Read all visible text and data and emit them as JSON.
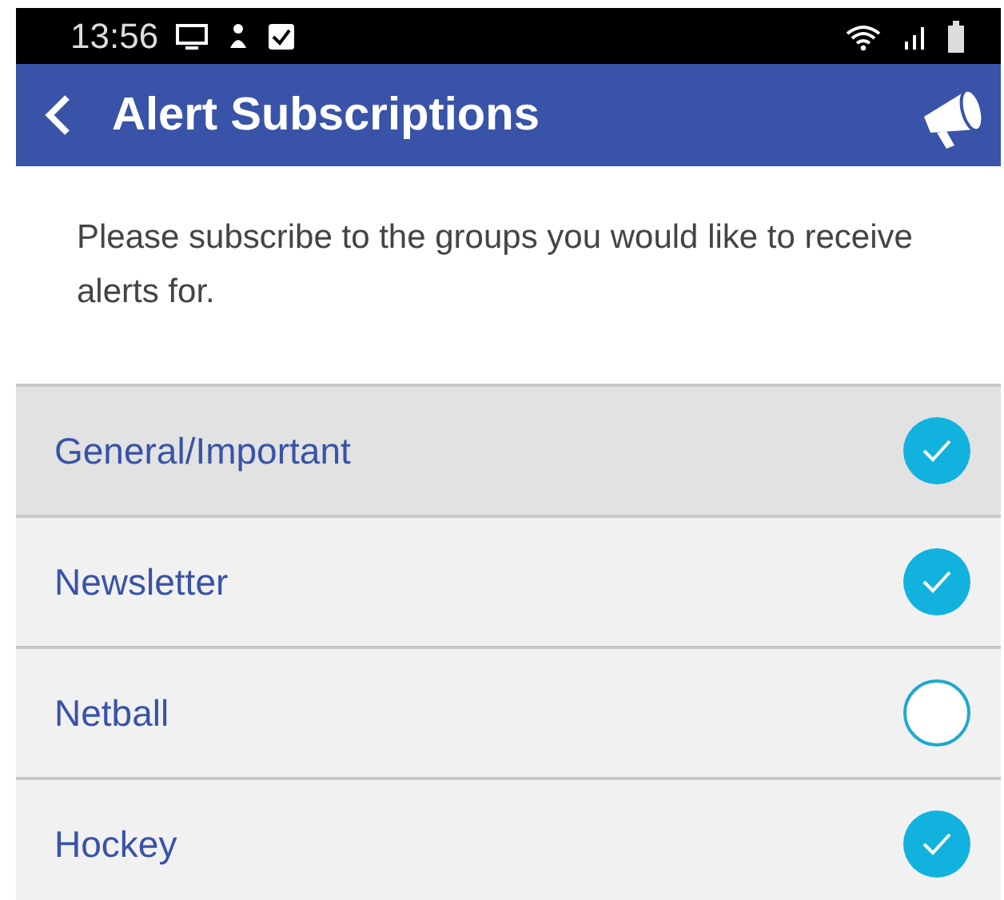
{
  "status_bar": {
    "time": "13:56"
  },
  "app_bar": {
    "title": "Alert Subscriptions"
  },
  "intro": "Please subscribe to the groups you would like to receive alerts for.",
  "groups": [
    {
      "label": "General/Important",
      "checked": true,
      "selected": true
    },
    {
      "label": "Newsletter",
      "checked": true,
      "selected": false
    },
    {
      "label": "Netball",
      "checked": false,
      "selected": false
    },
    {
      "label": "Hockey",
      "checked": true,
      "selected": false
    }
  ]
}
